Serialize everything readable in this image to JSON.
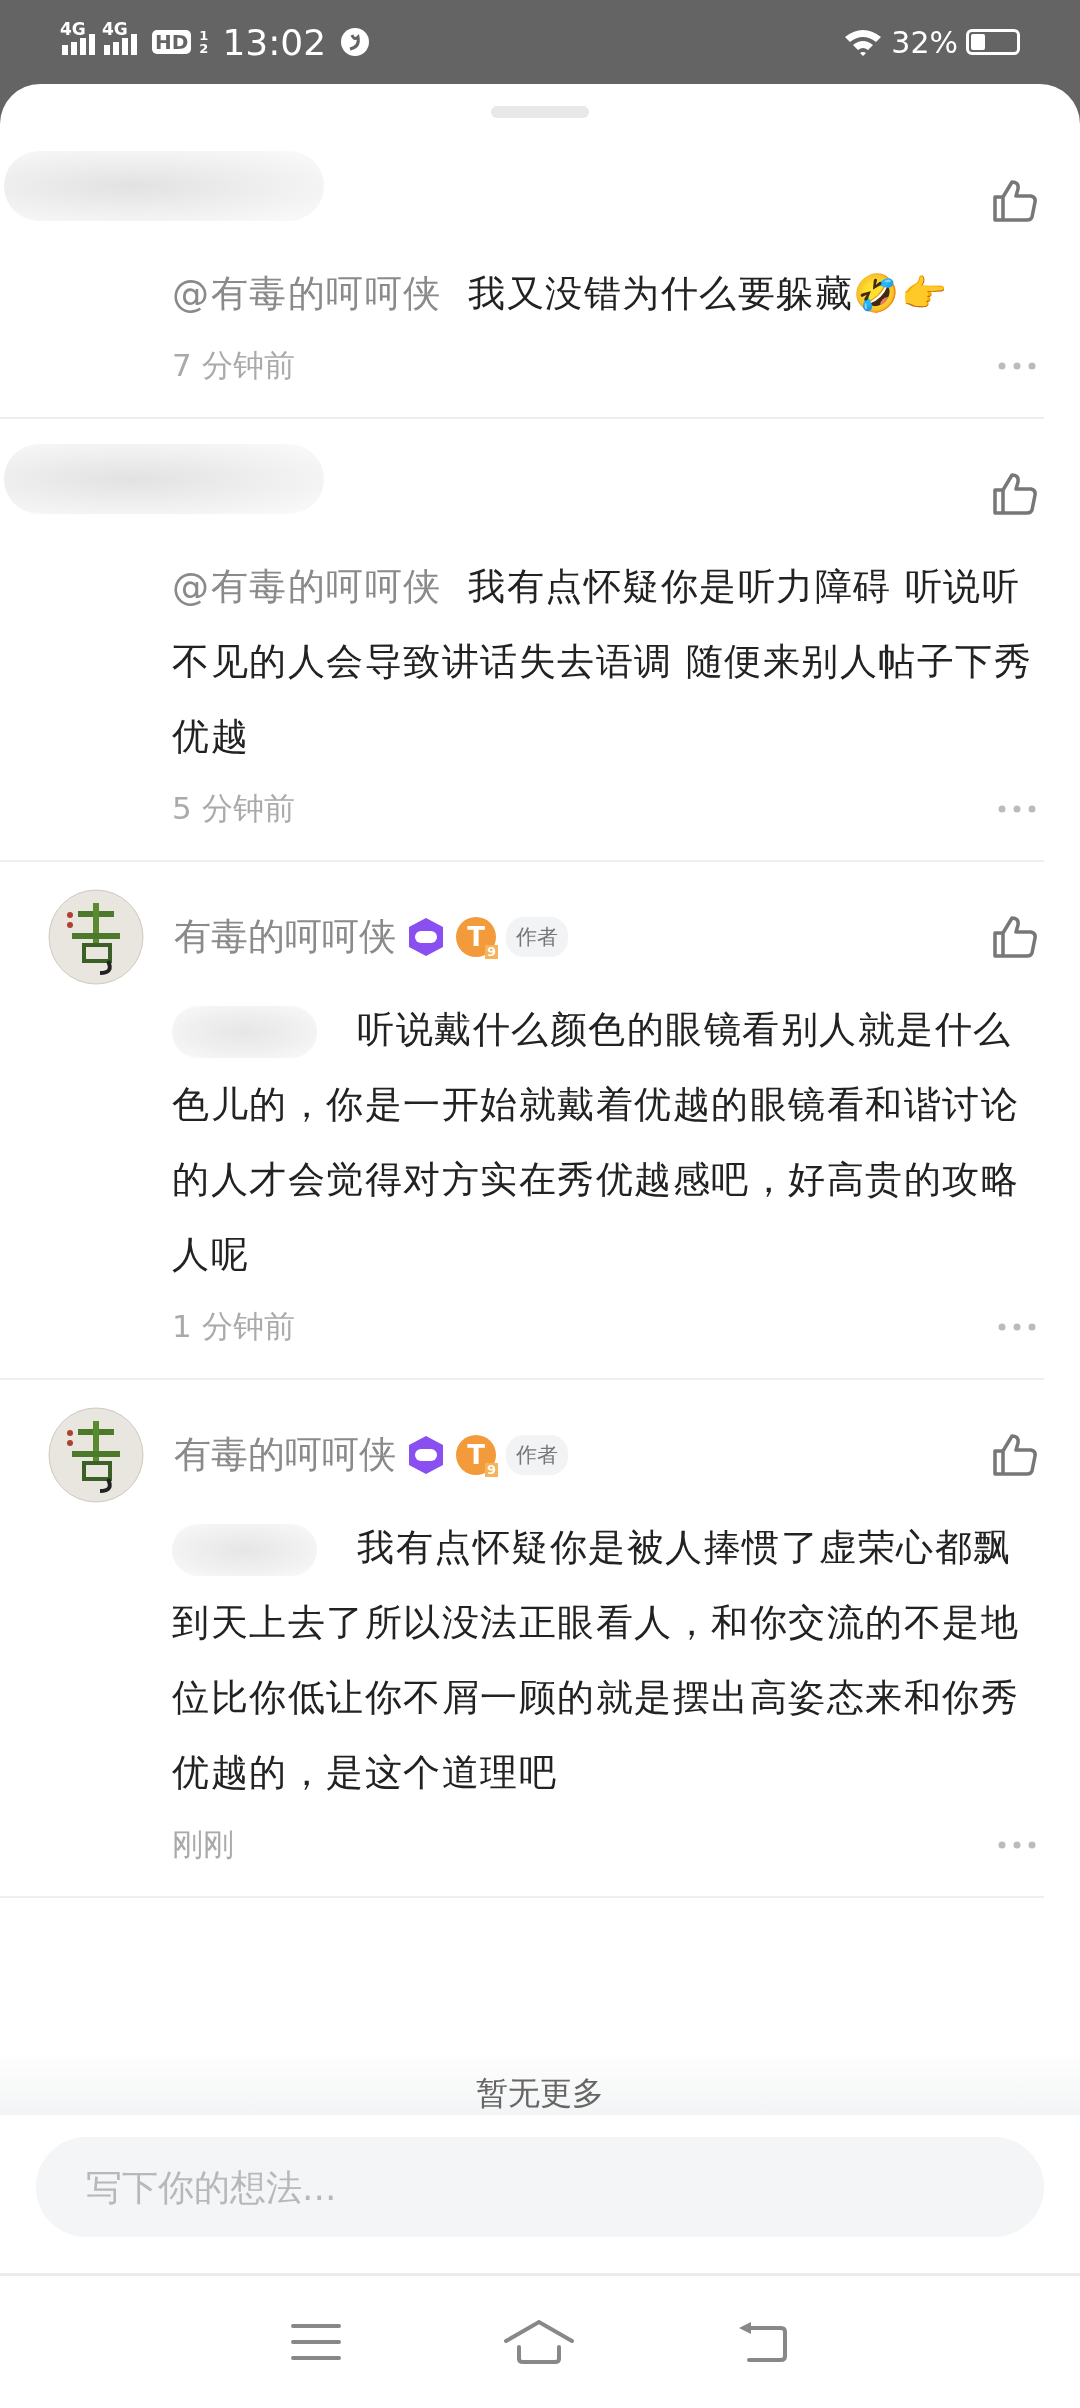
{
  "status_bar": {
    "networks": [
      "4G",
      "4G"
    ],
    "hd": "HD",
    "hd_slots": [
      "1",
      "2"
    ],
    "time": "13:02",
    "battery": "32%"
  },
  "comments": [
    {
      "kind": "reply",
      "mention": "@有毒的呵呵侠",
      "text": "我又没错为什么要躲藏🤣👉",
      "time": "7 分钟前"
    },
    {
      "kind": "reply",
      "mention": "@有毒的呵呵侠",
      "text": "我有点怀疑你是听力障碍 听说听不见的人会导致讲话失去语调 随便来别人帖子下秀优越",
      "time": "5 分钟前"
    },
    {
      "kind": "author",
      "author": "有毒的呵呵侠",
      "badge_level": "T",
      "badge_sub": "9",
      "badge": "作者",
      "text": "听说戴什么颜色的眼镜看别人就是什么色儿的，你是一开始就戴着优越的眼镜看和谐讨论的人才会觉得对方实在秀优越感吧，好高贵的攻略人呢",
      "time": "1 分钟前"
    },
    {
      "kind": "author",
      "author": "有毒的呵呵侠",
      "badge_level": "T",
      "badge_sub": "9",
      "badge": "作者",
      "text": "我有点怀疑你是被人捧惯了虚荣心都飘到天上去了所以没法正眼看人，和你交流的不是地位比你低让你不屑一顾的就是摆出高姿态来和你秀优越的，是这个道理吧",
      "time": "刚刚"
    }
  ],
  "end_note": "暂无更多",
  "input": {
    "placeholder": "写下你的想法..."
  }
}
